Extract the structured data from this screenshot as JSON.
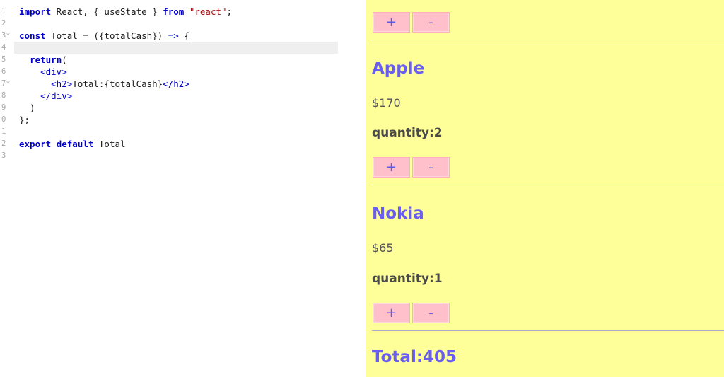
{
  "editor": {
    "lines": [
      {
        "n": "1",
        "fold": false,
        "parts": [
          [
            "kw",
            "import"
          ],
          [
            "",
            " React, { useState } "
          ],
          [
            "kw",
            "from"
          ],
          [
            "",
            " "
          ],
          [
            "str",
            "\"react\""
          ],
          [
            "",
            ";"
          ]
        ]
      },
      {
        "n": "2",
        "fold": false,
        "parts": []
      },
      {
        "n": "3",
        "fold": true,
        "parts": [
          [
            "kw",
            "const"
          ],
          [
            "",
            " Total = ({totalCash}) "
          ],
          [
            "kwn",
            "=>"
          ],
          [
            "",
            " {"
          ]
        ]
      },
      {
        "n": "4",
        "fold": false,
        "parts": [],
        "active": true
      },
      {
        "n": "5",
        "fold": false,
        "parts": [
          [
            "",
            "  "
          ],
          [
            "kw",
            "return"
          ],
          [
            "",
            "("
          ]
        ]
      },
      {
        "n": "6",
        "fold": false,
        "parts": [
          [
            "",
            "    "
          ],
          [
            "tag",
            "<div>"
          ]
        ]
      },
      {
        "n": "7",
        "fold": true,
        "parts": [
          [
            "",
            "      "
          ],
          [
            "tag",
            "<h2>"
          ],
          [
            "",
            "Total:{totalCash}"
          ],
          [
            "tag",
            "</h2>"
          ]
        ]
      },
      {
        "n": "8",
        "fold": false,
        "parts": [
          [
            "",
            "    "
          ],
          [
            "tag",
            "</div>"
          ]
        ]
      },
      {
        "n": "9",
        "fold": false,
        "parts": [
          [
            "",
            "  )"
          ]
        ]
      },
      {
        "n": "0",
        "fold": false,
        "parts": [
          [
            "",
            "};"
          ]
        ]
      },
      {
        "n": "1",
        "fold": false,
        "parts": []
      },
      {
        "n": "2",
        "fold": false,
        "parts": [
          [
            "kw",
            "export"
          ],
          [
            "",
            " "
          ],
          [
            "kw",
            "default"
          ],
          [
            "",
            " Total"
          ]
        ]
      },
      {
        "n": "3",
        "fold": false,
        "parts": []
      }
    ]
  },
  "preview": {
    "top_buttons": {
      "plus": "+",
      "minus": "-"
    },
    "products": [
      {
        "name": "Apple",
        "price": "$170",
        "quantity": "quantity:2",
        "plus": "+",
        "minus": "-"
      },
      {
        "name": "Nokia",
        "price": "$65",
        "quantity": "quantity:1",
        "plus": "+",
        "minus": "-"
      }
    ],
    "total": "Total:405"
  },
  "colors": {
    "preview_bg": "#ffff99",
    "button_bg": "#ffc0cb",
    "accent": "#6a5ef0"
  }
}
